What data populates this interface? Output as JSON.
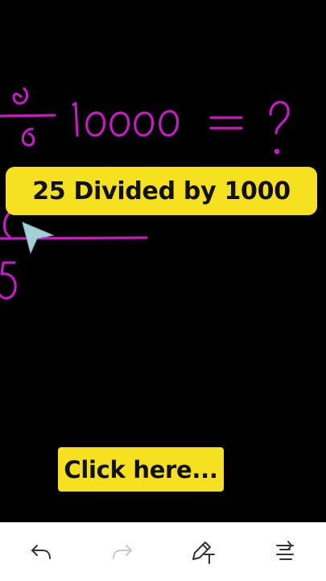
{
  "banner": {
    "title": "25 Divided by 1000"
  },
  "cta": {
    "label": "Click here..."
  },
  "colors": {
    "accent": "#f5e11f",
    "ink": "#c01fc0",
    "background": "#000000",
    "toolbar_bg": "#ffffff",
    "icon": "#333333",
    "icon_disabled": "#c8c8c8"
  },
  "toolbar": {
    "items": [
      {
        "icon": "undo-icon",
        "enabled": true
      },
      {
        "icon": "redo-icon",
        "enabled": false
      },
      {
        "icon": "pen-text-icon",
        "enabled": true
      },
      {
        "icon": "text-direction-icon",
        "enabled": true
      }
    ]
  }
}
